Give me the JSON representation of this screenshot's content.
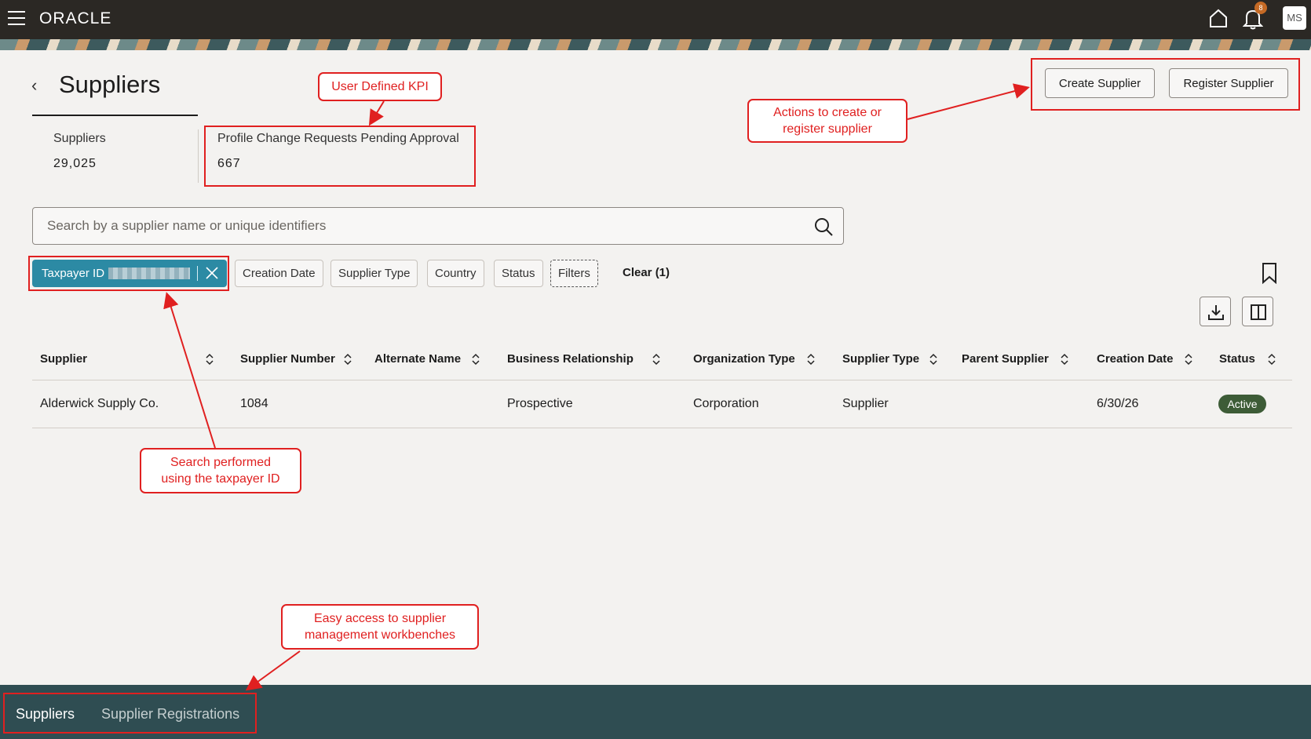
{
  "header": {
    "logo": "ORACLE",
    "notification_count": "8",
    "user_initials": "MS"
  },
  "page": {
    "title": "Suppliers"
  },
  "kpis": [
    {
      "label": "Suppliers",
      "value": "29,025"
    },
    {
      "label": "Profile Change Requests Pending Approval",
      "value": "667"
    }
  ],
  "actions": {
    "create_label": "Create Supplier",
    "register_label": "Register Supplier"
  },
  "search": {
    "placeholder": "Search by a supplier name or unique identifiers"
  },
  "filters": {
    "active_chip": "Taxpayer ID",
    "chips": [
      "Creation Date",
      "Supplier Type",
      "Country",
      "Status",
      "Filters"
    ],
    "clear_label": "Clear (1)"
  },
  "table": {
    "columns": [
      "Supplier",
      "Supplier Number",
      "Alternate Name",
      "Business Relationship",
      "Organization Type",
      "Supplier Type",
      "Parent Supplier",
      "Creation Date",
      "Status"
    ],
    "rows": [
      {
        "supplier": "Alderwick Supply Co.",
        "supplier_number": "1084",
        "alternate_name": "",
        "business_relationship": "Prospective",
        "organization_type": "Corporation",
        "supplier_type": "Supplier",
        "parent_supplier": "",
        "creation_date": "6/30/26",
        "status": "Active"
      }
    ]
  },
  "annotations": {
    "kpi": "User Defined KPI",
    "actions": "Actions to create or register supplier",
    "search": "Search performed using the taxpayer ID",
    "workbench": "Easy access to supplier management workbenches"
  },
  "footer": {
    "tabs": [
      "Suppliers",
      "Supplier Registrations"
    ]
  },
  "colors": {
    "header_bg": "#2b2824",
    "chip_active": "#2c8aa4",
    "status_active": "#3d5c37",
    "footer_bg": "#2f4d52",
    "annotation": "#e02020"
  }
}
